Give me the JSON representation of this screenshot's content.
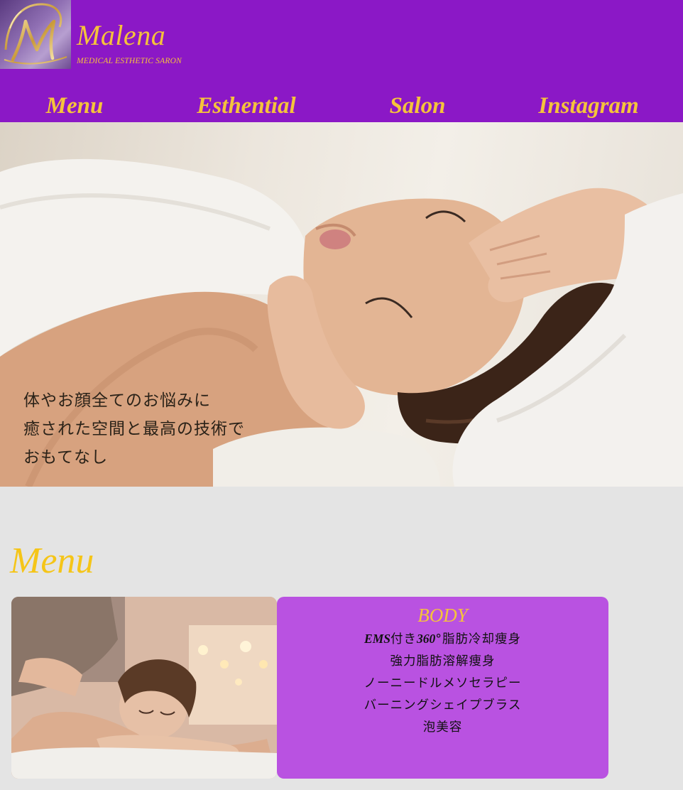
{
  "brand": {
    "name": "Malena",
    "subtitle": "MEDICAL ESTHETIC SARON",
    "logo_letter": "M"
  },
  "nav": {
    "items": [
      "Menu",
      "Esthential",
      "Salon",
      "Instagram"
    ]
  },
  "hero": {
    "lines": [
      "体やお顔全てのお悩みに",
      "癒された空間と最高の技術で",
      "おもてなし"
    ]
  },
  "menu": {
    "title": "Menu",
    "card": {
      "title": "BODY",
      "item0_em": "EMS",
      "item0_a": "付き",
      "item0_num": "360",
      "item0_b": "°脂肪冷却痩身",
      "items": [
        "強力脂肪溶解痩身",
        "ノーニードルメソセラピー",
        "バーニングシェイプブラス",
        "泡美容"
      ]
    }
  },
  "colors": {
    "header_bg": "#8b18c6",
    "accent_gold": "#f5c33b",
    "card_bg": "#b952e1",
    "page_bg": "#e4e4e4"
  },
  "icons": {
    "logo": "monogram-m-icon"
  }
}
